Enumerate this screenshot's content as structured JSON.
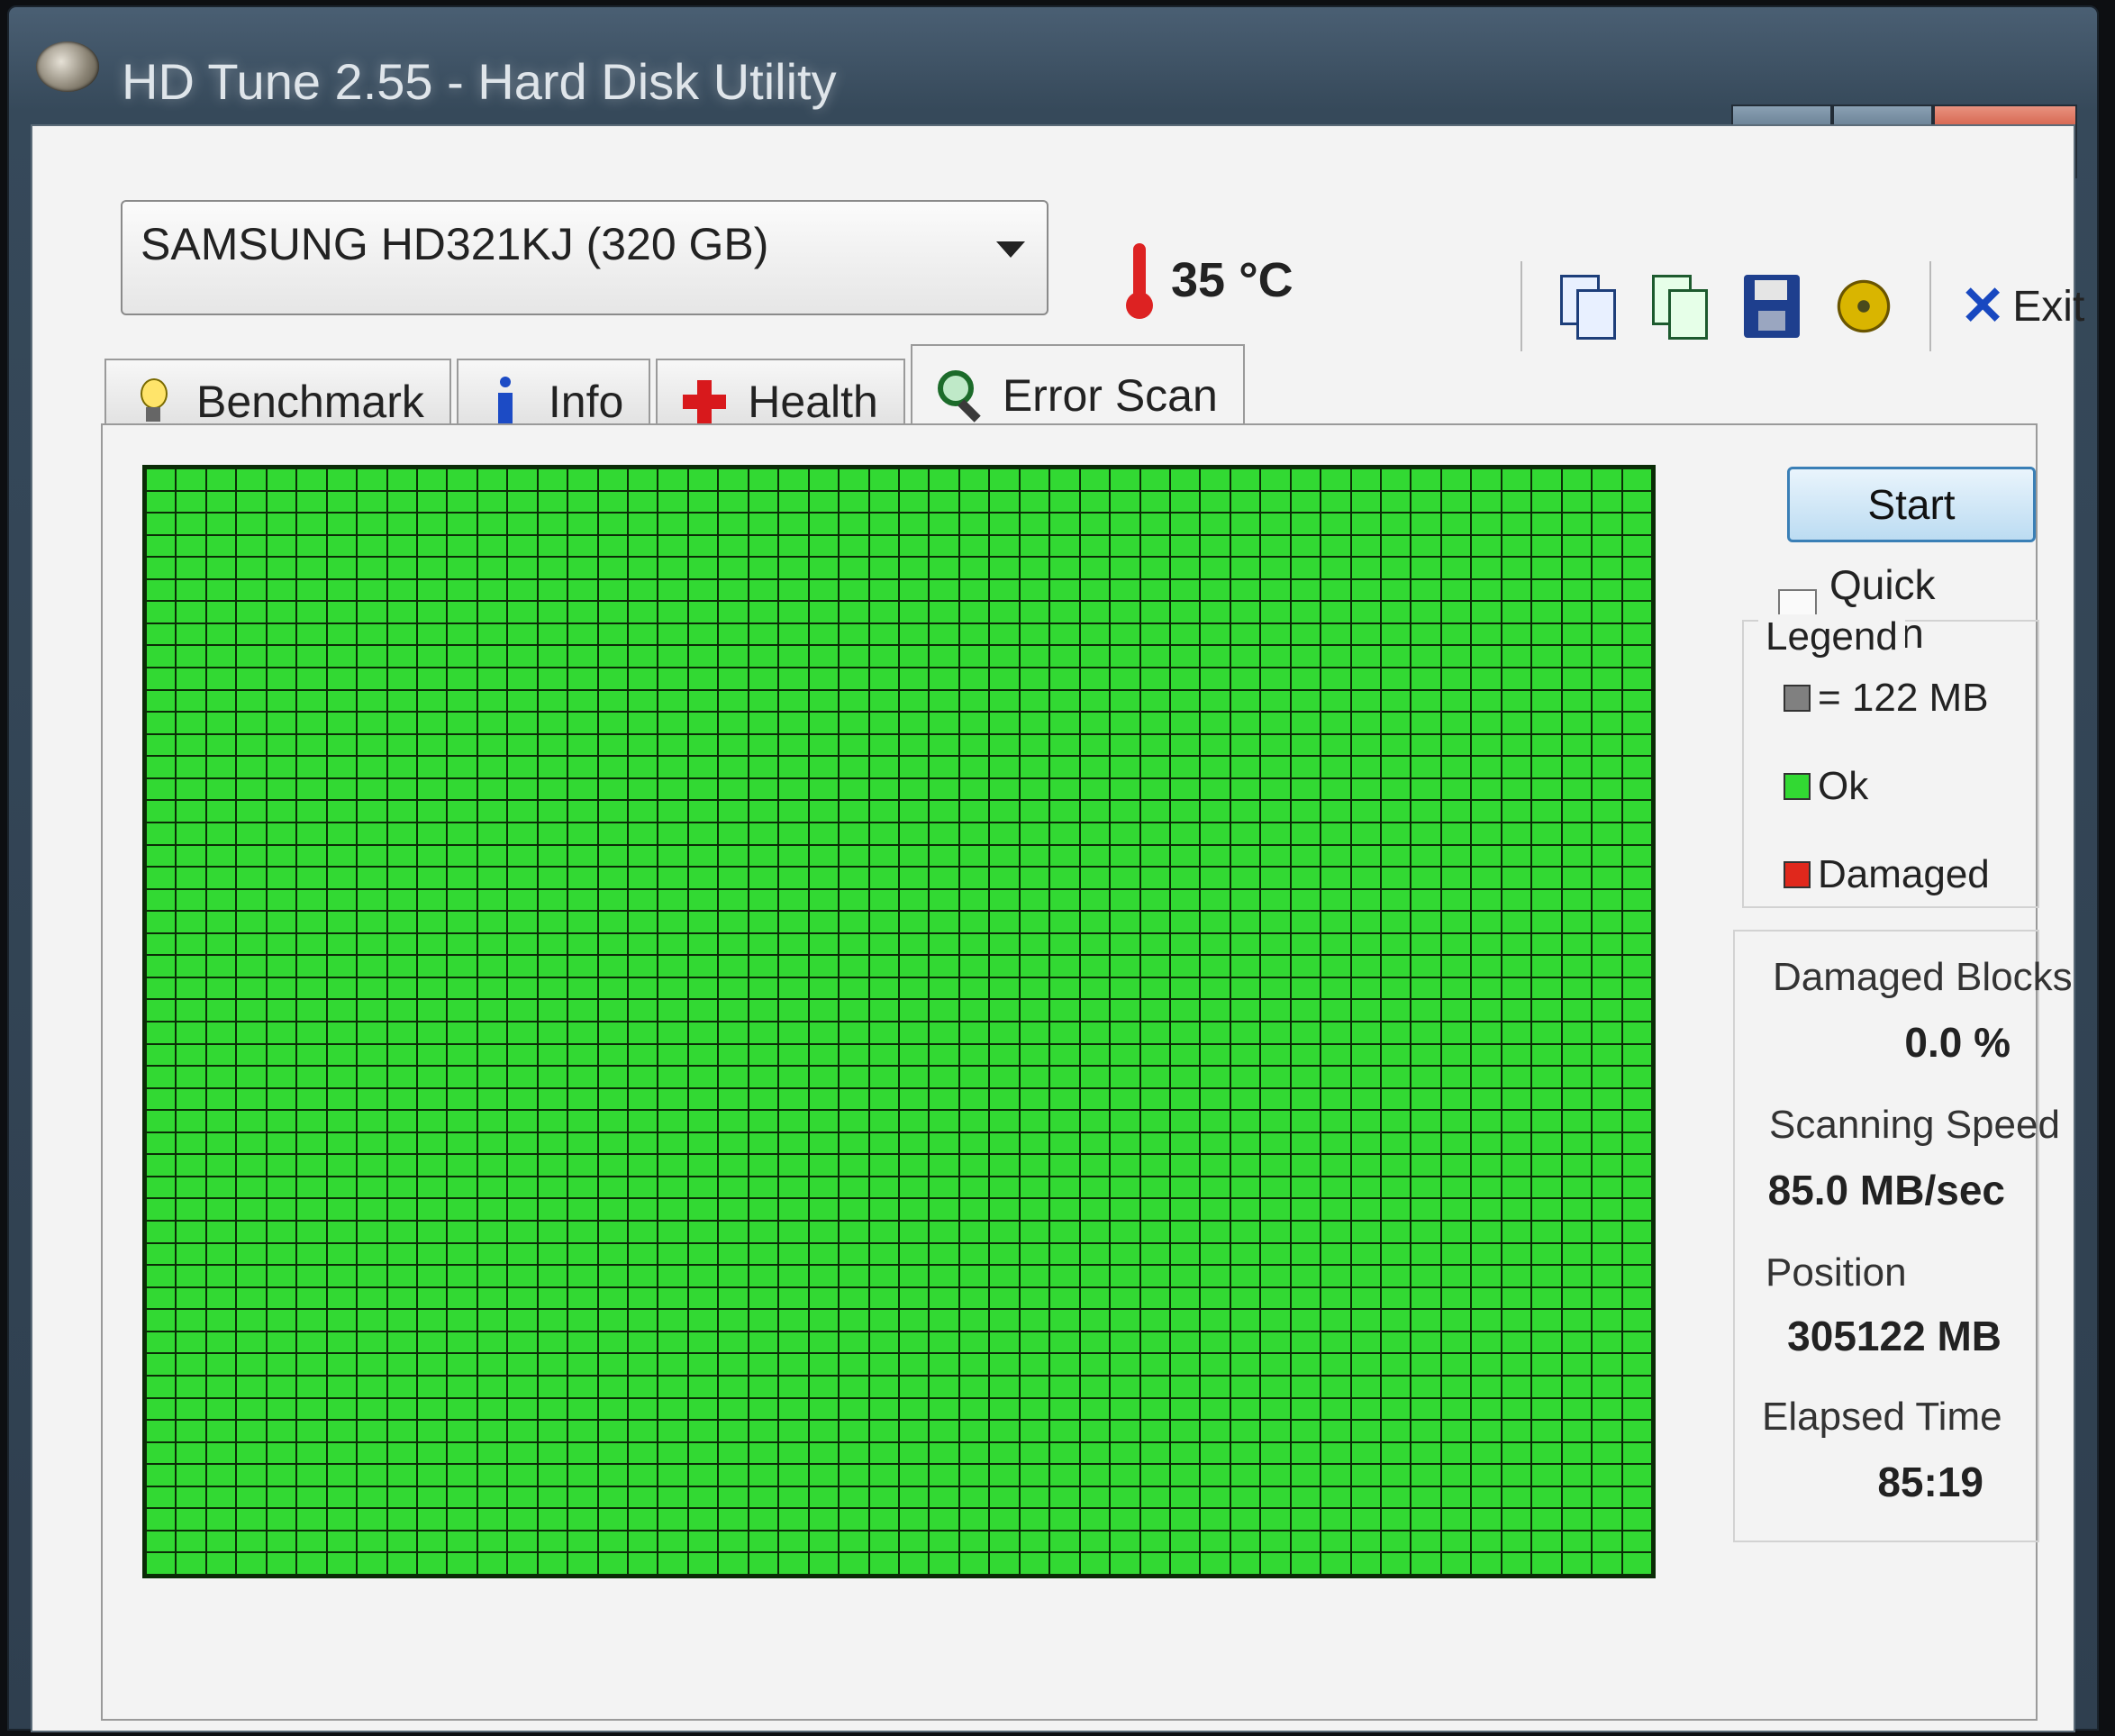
{
  "window": {
    "title": "HD Tune 2.55 - Hard Disk Utility",
    "controls": {
      "minimize": "▁",
      "maximize": "▢",
      "close": "X"
    }
  },
  "drive": {
    "selected": "SAMSUNG HD321KJ (320 GB)"
  },
  "temperature": {
    "value": "35 °C"
  },
  "toolbar": {
    "icons": [
      "copy-text-icon",
      "copy-screenshot-icon",
      "save-icon",
      "options-gear-icon"
    ],
    "exit_label": "Exit"
  },
  "tabs": [
    {
      "label": "Benchmark",
      "icon": "bulb-icon"
    },
    {
      "label": "Info",
      "icon": "info-icon"
    },
    {
      "label": "Health",
      "icon": "health-cross-icon"
    },
    {
      "label": "Error Scan",
      "icon": "magnifier-icon",
      "active": true
    }
  ],
  "scan_map": {
    "block_color": "#32d933",
    "status": "Ok"
  },
  "controls": {
    "start_label": "Start",
    "quick_scan_label": "Quick Scan",
    "quick_scan_checked": false
  },
  "legend": {
    "title": "Legend",
    "block_size": "= 122 MB",
    "ok": "Ok",
    "damaged": "Damaged",
    "colors": {
      "block": "#808080",
      "ok": "#32d933",
      "damaged": "#e0281c"
    }
  },
  "stats": {
    "damaged_blocks_label": "Damaged Blocks",
    "damaged_blocks_value": "0.0 %",
    "scanning_speed_label": "Scanning Speed",
    "scanning_speed_value": "85.0 MB/sec",
    "position_label": "Position",
    "position_value": "305122 MB",
    "elapsed_time_label": "Elapsed Time",
    "elapsed_time_value": "85:19"
  }
}
